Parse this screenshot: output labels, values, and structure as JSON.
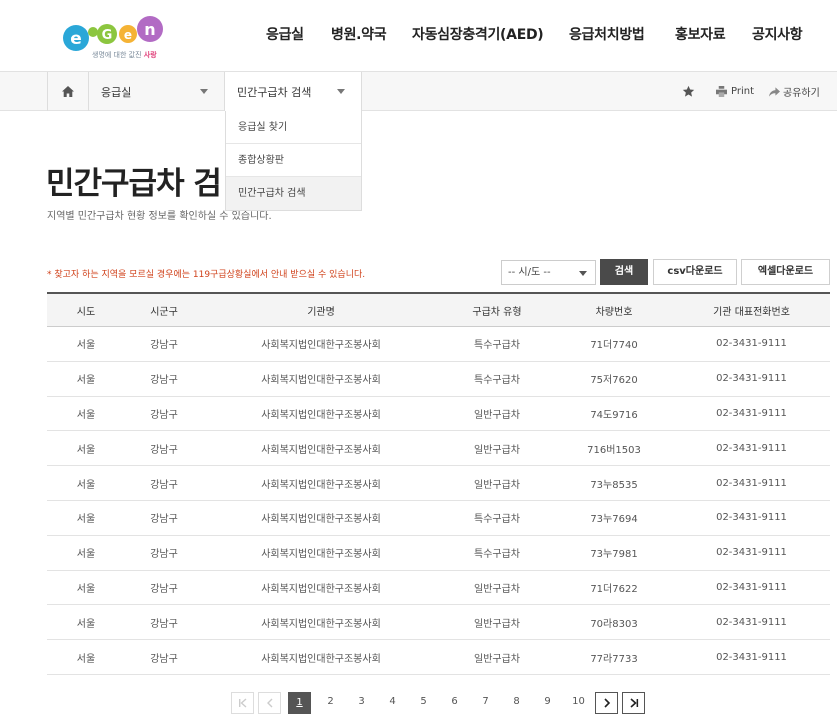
{
  "header": {
    "logo_tagline_prefix": "생명에 대한 값진",
    "logo_tagline_highlight": "사랑",
    "nav": [
      "응급실",
      "병원.약국",
      "자동심장충격기(AED)",
      "응급처치방법",
      "홍보자료",
      "공지사항"
    ]
  },
  "location": {
    "depth1": "응급실",
    "depth2": "민간구급차 검색",
    "dropdown": [
      "응급실 찾기",
      "종합상황판",
      "민간구급차 검색"
    ],
    "print_label": "Print",
    "share_label": "공유하기"
  },
  "page": {
    "title": "민간구급차 검",
    "description": "지역별 민간구급차 현황 정보를 확인하실 수 있습니다."
  },
  "search": {
    "notice": "* 찾고자 하는 지역을 모르실 경우에는 119구급상황실에서 안내 받으실 수 있습니다.",
    "region_select": "-- 시/도 --",
    "search_button": "검색",
    "csv_button": "csv다운로드",
    "excel_button": "엑셀다운로드"
  },
  "table": {
    "headers": [
      "시도",
      "시군구",
      "기관명",
      "구급차 유형",
      "차량번호",
      "기관 대표전화번호"
    ],
    "rows": [
      [
        "서울",
        "강남구",
        "사회복지법인대한구조봉사회",
        "특수구급차",
        "71더7740",
        "02-3431-9111"
      ],
      [
        "서울",
        "강남구",
        "사회복지법인대한구조봉사회",
        "특수구급차",
        "75저7620",
        "02-3431-9111"
      ],
      [
        "서울",
        "강남구",
        "사회복지법인대한구조봉사회",
        "일반구급차",
        "74도9716",
        "02-3431-9111"
      ],
      [
        "서울",
        "강남구",
        "사회복지법인대한구조봉사회",
        "일반구급차",
        "716버1503",
        "02-3431-9111"
      ],
      [
        "서울",
        "강남구",
        "사회복지법인대한구조봉사회",
        "일반구급차",
        "73누8535",
        "02-3431-9111"
      ],
      [
        "서울",
        "강남구",
        "사회복지법인대한구조봉사회",
        "특수구급차",
        "73누7694",
        "02-3431-9111"
      ],
      [
        "서울",
        "강남구",
        "사회복지법인대한구조봉사회",
        "특수구급차",
        "73누7981",
        "02-3431-9111"
      ],
      [
        "서울",
        "강남구",
        "사회복지법인대한구조봉사회",
        "일반구급차",
        "71더7622",
        "02-3431-9111"
      ],
      [
        "서울",
        "강남구",
        "사회복지법인대한구조봉사회",
        "일반구급차",
        "70라8303",
        "02-3431-9111"
      ],
      [
        "서울",
        "강남구",
        "사회복지법인대한구조봉사회",
        "일반구급차",
        "77라7733",
        "02-3431-9111"
      ]
    ]
  },
  "pagination": {
    "pages": [
      "1",
      "2",
      "3",
      "4",
      "5",
      "6",
      "7",
      "8",
      "9",
      "10"
    ],
    "current": "1"
  },
  "colors": {
    "notice": "#d0421b",
    "dark_button": "#4a4a4a",
    "logo_blue": "#2aa7d8",
    "logo_green": "#8cc63f",
    "logo_pink": "#e0407a"
  }
}
